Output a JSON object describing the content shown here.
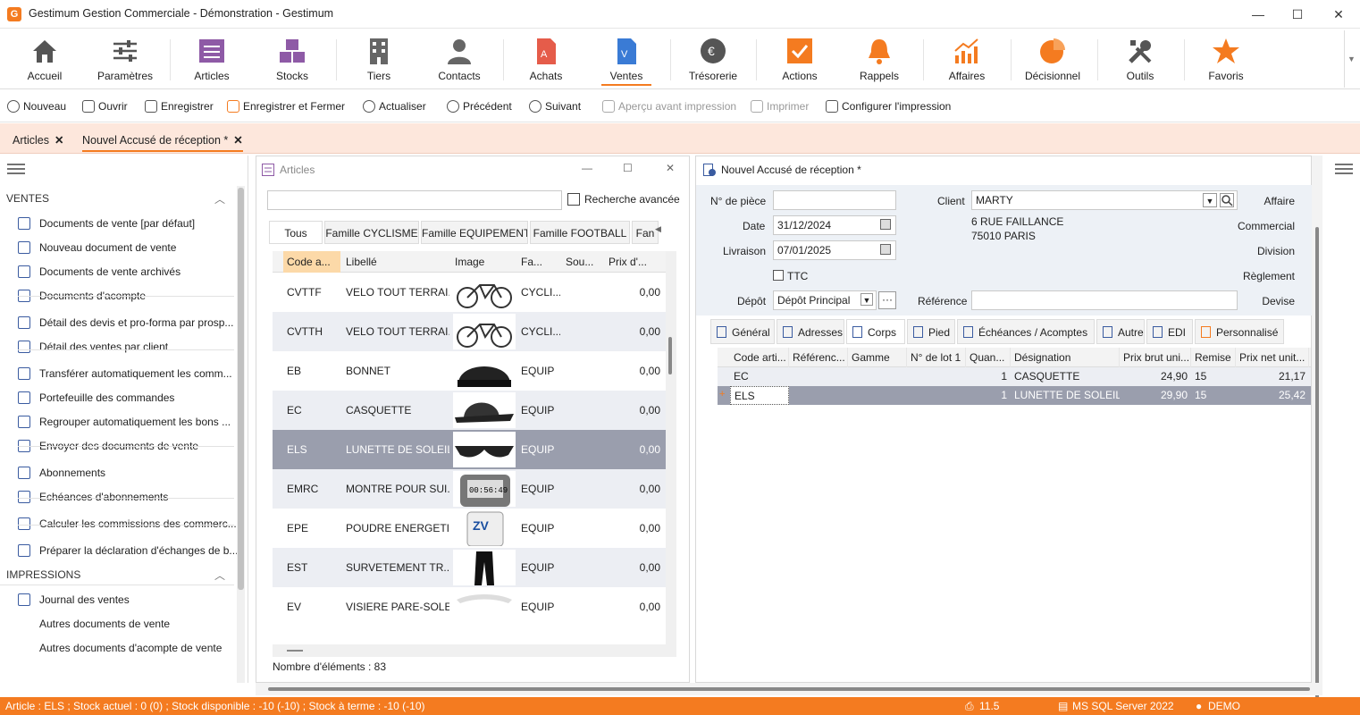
{
  "window": {
    "title": "Gestimum Gestion Commerciale - Démonstration - Gestimum",
    "logo": "G"
  },
  "ribbon": [
    {
      "label": "Accueil",
      "icon": "home-icon"
    },
    {
      "label": "Paramètres",
      "icon": "sliders-icon"
    },
    {
      "label": "Articles",
      "icon": "articles-icon"
    },
    {
      "label": "Stocks",
      "icon": "stocks-icon"
    },
    {
      "label": "Tiers",
      "icon": "building-icon"
    },
    {
      "label": "Contacts",
      "icon": "person-icon"
    },
    {
      "label": "Achats",
      "icon": "purchase-doc-icon"
    },
    {
      "label": "Ventes",
      "icon": "sales-doc-icon"
    },
    {
      "label": "Trésorerie",
      "icon": "euro-icon"
    },
    {
      "label": "Actions",
      "icon": "checkbox-icon"
    },
    {
      "label": "Rappels",
      "icon": "bell-icon"
    },
    {
      "label": "Affaires",
      "icon": "chart-up-icon"
    },
    {
      "label": "Décisionnel",
      "icon": "pie-icon"
    },
    {
      "label": "Outils",
      "icon": "tools-icon"
    },
    {
      "label": "Favoris",
      "icon": "star-icon"
    }
  ],
  "toolbar": [
    {
      "label": "Nouveau"
    },
    {
      "label": "Ouvrir"
    },
    {
      "label": "Enregistrer"
    },
    {
      "label": "Enregistrer et Fermer"
    },
    {
      "label": "Actualiser"
    },
    {
      "label": "Précédent"
    },
    {
      "label": "Suivant"
    },
    {
      "label": "Aperçu avant impression",
      "disabled": true
    },
    {
      "label": "Imprimer",
      "disabled": true
    },
    {
      "label": "Configurer l'impression"
    }
  ],
  "doc_tabs": [
    {
      "label": "Articles"
    },
    {
      "label": "Nouvel Accusé de réception *"
    }
  ],
  "nav": {
    "sec1": "VENTES",
    "items1": [
      "Documents de vente [par défaut]",
      "Nouveau document de vente",
      "Documents de vente archivés",
      "Documents d'acompte",
      "Détail des devis et pro-forma par prosp...",
      "Détail des ventes par client",
      "Transférer automatiquement les comm...",
      "Portefeuille des commandes",
      "Regrouper automatiquement les bons ...",
      "Envoyer des documents de vente",
      "Abonnements",
      "Echéances d'abonnements",
      "Calculer les commissions des commerc...",
      "Préparer la déclaration d'échanges de b..."
    ],
    "sec2": "IMPRESSIONS",
    "items2": [
      "Journal des ventes",
      "Autres documents de vente",
      "Autres documents d'acompte de vente"
    ]
  },
  "articles": {
    "title": "Articles",
    "search_btn": "Recherche avancée",
    "tabs": [
      "Tous",
      "Famille CYCLISME",
      "Famille EQUIPEMENT",
      "Famille FOOTBALL",
      "Fan"
    ],
    "columns": [
      "Code a...",
      "Libellé",
      "Image",
      "Fa...",
      "Sou...",
      "Prix d'..."
    ],
    "rows": [
      {
        "code": "CVTTF",
        "lib": "VELO TOUT TERRAI...",
        "img": "bike-image",
        "fam": "CYCLI...",
        "prix": "0,00"
      },
      {
        "code": "CVTTH",
        "lib": "VELO TOUT TERRAI...",
        "img": "bike-image",
        "fam": "CYCLI...",
        "prix": "0,00"
      },
      {
        "code": "EB",
        "lib": "BONNET",
        "img": "beanie-image",
        "fam": "EQUIP",
        "prix": "0,00"
      },
      {
        "code": "EC",
        "lib": "CASQUETTE",
        "img": "cap-image",
        "fam": "EQUIP",
        "prix": "0,00"
      },
      {
        "code": "ELS",
        "lib": "LUNETTE DE SOLEIL",
        "img": "sunglasses-image",
        "fam": "EQUIP",
        "prix": "0,00"
      },
      {
        "code": "EMRC",
        "lib": "MONTRE POUR SUI...",
        "img": "watch-image",
        "fam": "EQUIP",
        "prix": "0,00"
      },
      {
        "code": "EPE",
        "lib": "POUDRE ENERGETI...",
        "img": "powder-image",
        "fam": "EQUIP",
        "prix": "0,00"
      },
      {
        "code": "EST",
        "lib": "SURVETEMENT TR...",
        "img": "tracksuit-image",
        "fam": "EQUIP",
        "prix": "0,00"
      },
      {
        "code": "EV",
        "lib": "VISIERE PARE-SOLEIL",
        "img": "visor-image",
        "fam": "EQUIP",
        "prix": "0,00"
      }
    ],
    "count": "Nombre d'éléments : 83"
  },
  "doc": {
    "title": "Nouvel Accusé de réception *",
    "labels": {
      "piece": "N° de pièce",
      "date": "Date",
      "livraison": "Livraison",
      "ttc": "TTC",
      "depot": "Dépôt",
      "client": "Client",
      "reference": "Référence",
      "affaire": "Affaire",
      "commercial": "Commercial",
      "division": "Division",
      "reglement": "Règlement",
      "devise": "Devise"
    },
    "values": {
      "piece": "",
      "date": "31/12/2024",
      "livraison": "07/01/2025",
      "depot": "Dépôt Principal",
      "client": "MARTY",
      "addr1": "6 RUE FAILLANCE",
      "addr2": "75010 PARIS",
      "reference": ""
    },
    "tabs": [
      "Général",
      "Adresses",
      "Corps",
      "Pied",
      "Échéances / Acomptes",
      "Autre",
      "EDI",
      "Personnalisé"
    ],
    "columns": [
      "Code arti...",
      "Référenc...",
      "Gamme",
      "N° de lot 1",
      "Quan...",
      "Désignation",
      "Prix brut uni...",
      "Remise",
      "Prix net unit..."
    ],
    "lines": [
      {
        "code": "EC",
        "qty": "1",
        "des": "CASQUETTE",
        "brut": "24,90",
        "remise": "15",
        "net": "21,17"
      },
      {
        "code": "ELS",
        "qty": "1",
        "des": "LUNETTE DE SOLEIL",
        "brut": "29,90",
        "remise": "15",
        "net": "25,42"
      }
    ]
  },
  "status": {
    "left": "Article : ELS ; Stock actuel : 0 (0) ; Stock disponible : -10 (-10) ; Stock à terme : -10 (-10)",
    "version": "11.5",
    "db": "MS SQL Server 2022",
    "user": "DEMO"
  },
  "colors": {
    "accent": "#f47b20",
    "purple": "#8e5aa6",
    "blue": "#3a7bd5",
    "selrow": "#9a9ead"
  }
}
